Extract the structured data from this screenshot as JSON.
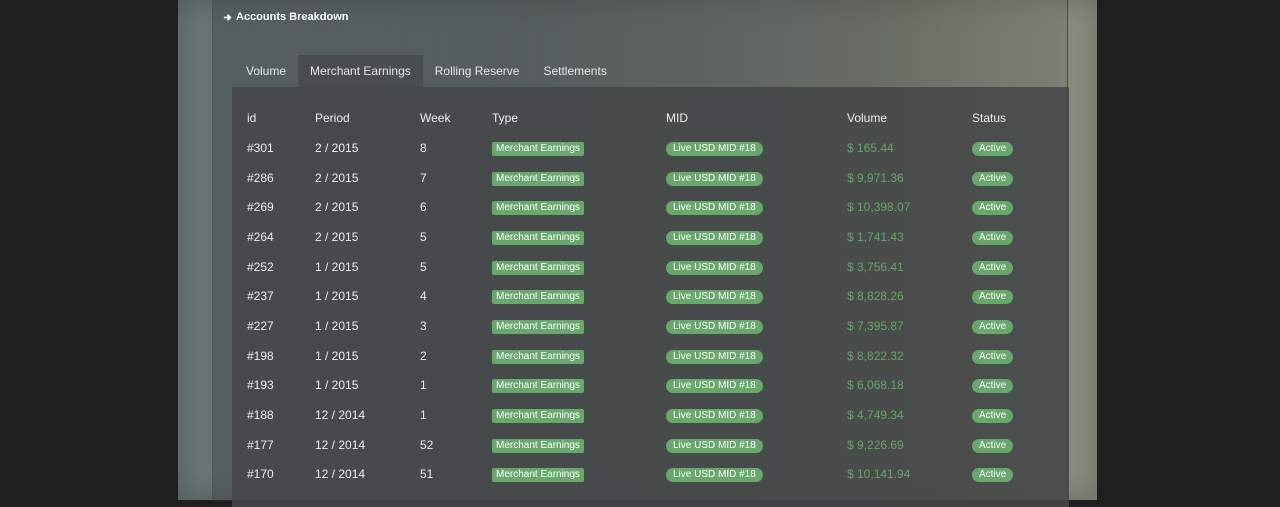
{
  "panel": {
    "title": "Accounts Breakdown",
    "title_icon": "arrow-right-icon"
  },
  "tabs": [
    {
      "label": "Volume",
      "active": false
    },
    {
      "label": "Merchant Earnings",
      "active": true
    },
    {
      "label": "Rolling Reserve",
      "active": false
    },
    {
      "label": "Settlements",
      "active": false
    }
  ],
  "table": {
    "headers": [
      "id",
      "Period",
      "Week",
      "Type",
      "MID",
      "Volume",
      "Status"
    ],
    "rows": [
      {
        "id": "#301",
        "period": "2 / 2015",
        "week": "8",
        "type": "Merchant Earnings",
        "mid": "Live USD MID #18",
        "volume": "$ 165.44",
        "status": "Active"
      },
      {
        "id": "#286",
        "period": "2 / 2015",
        "week": "7",
        "type": "Merchant Earnings",
        "mid": "Live USD MID #18",
        "volume": "$ 9,971.36",
        "status": "Active"
      },
      {
        "id": "#269",
        "period": "2 / 2015",
        "week": "6",
        "type": "Merchant Earnings",
        "mid": "Live USD MID #18",
        "volume": "$ 10,398.07",
        "status": "Active"
      },
      {
        "id": "#264",
        "period": "2 / 2015",
        "week": "5",
        "type": "Merchant Earnings",
        "mid": "Live USD MID #18",
        "volume": "$ 1,741.43",
        "status": "Active"
      },
      {
        "id": "#252",
        "period": "1 / 2015",
        "week": "5",
        "type": "Merchant Earnings",
        "mid": "Live USD MID #18",
        "volume": "$ 3,756.41",
        "status": "Active"
      },
      {
        "id": "#237",
        "period": "1 / 2015",
        "week": "4",
        "type": "Merchant Earnings",
        "mid": "Live USD MID #18",
        "volume": "$ 8,828.26",
        "status": "Active"
      },
      {
        "id": "#227",
        "period": "1 / 2015",
        "week": "3",
        "type": "Merchant Earnings",
        "mid": "Live USD MID #18",
        "volume": "$ 7,395.87",
        "status": "Active"
      },
      {
        "id": "#198",
        "period": "1 / 2015",
        "week": "2",
        "type": "Merchant Earnings",
        "mid": "Live USD MID #18",
        "volume": "$ 8,822.32",
        "status": "Active"
      },
      {
        "id": "#193",
        "period": "1 / 2015",
        "week": "1",
        "type": "Merchant Earnings",
        "mid": "Live USD MID #18",
        "volume": "$ 6,068.18",
        "status": "Active"
      },
      {
        "id": "#188",
        "period": "12 / 2014",
        "week": "1",
        "type": "Merchant Earnings",
        "mid": "Live USD MID #18",
        "volume": "$ 4,749.34",
        "status": "Active"
      },
      {
        "id": "#177",
        "period": "12 / 2014",
        "week": "52",
        "type": "Merchant Earnings",
        "mid": "Live USD MID #18",
        "volume": "$ 9,226.69",
        "status": "Active"
      },
      {
        "id": "#170",
        "period": "12 / 2014",
        "week": "51",
        "type": "Merchant Earnings",
        "mid": "Live USD MID #18",
        "volume": "$ 10,141.94",
        "status": "Active"
      }
    ]
  },
  "colors": {
    "badge_green": "#69a86c",
    "volume_green": "#68a469",
    "panel_dark": "#444848"
  }
}
